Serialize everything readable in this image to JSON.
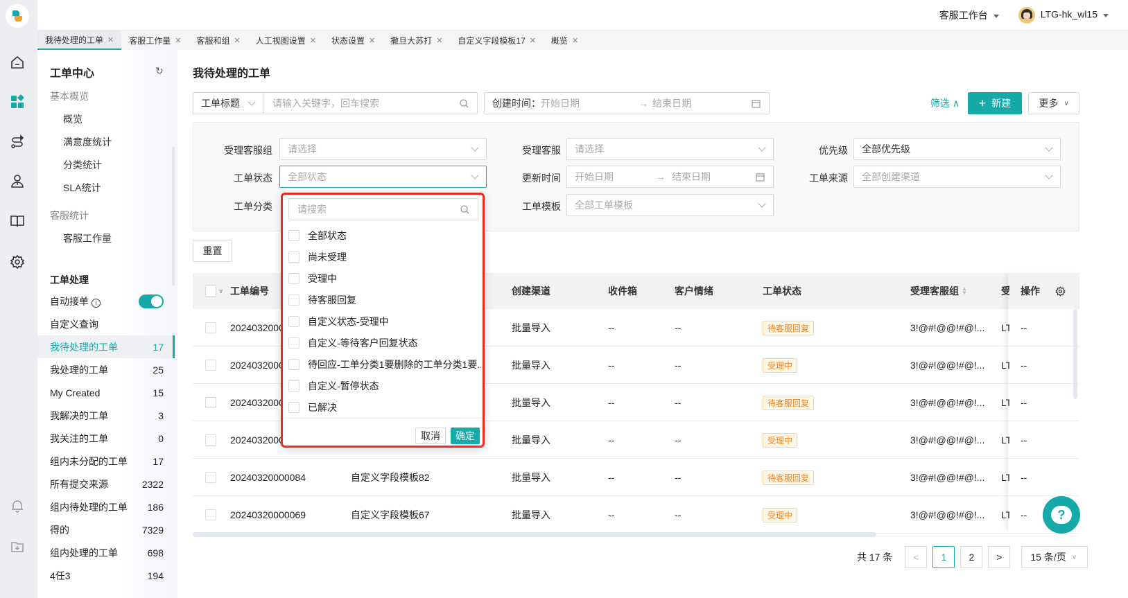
{
  "app": {
    "workspace_label": "客服工作台",
    "user_name": "LTG-hk_wl15",
    "brand_color": "#15a9a8"
  },
  "rail_icons": [
    "home-icon",
    "apps-icon",
    "route-icon",
    "agent-icon",
    "book-icon",
    "gear-icon",
    "bell-icon",
    "download-folder-icon"
  ],
  "tabs": [
    {
      "label": "我待处理的工单",
      "active": true
    },
    {
      "label": "客服工作量"
    },
    {
      "label": "客服和组"
    },
    {
      "label": "人工视图设置"
    },
    {
      "label": "状态设置"
    },
    {
      "label": "撒旦大苏打"
    },
    {
      "label": "自定义字段模板17"
    },
    {
      "label": "概览"
    }
  ],
  "sidebar": {
    "title": "工单中心",
    "group_basic": "基本概览",
    "basic_items": [
      "概览",
      "满意度统计",
      "分类统计",
      "SLA统计"
    ],
    "group_agent": "客服统计",
    "agent_items": [
      "客服工作量"
    ],
    "section_process": "工单处理",
    "auto_accept_label": "自动接单",
    "auto_accept_on": true,
    "custom_query": "自定义查询",
    "views": [
      {
        "label": "我待处理的工单",
        "count": "17",
        "active": true
      },
      {
        "label": "我处理的工单",
        "count": "25"
      },
      {
        "label": "My Created",
        "count": "15"
      },
      {
        "label": "我解决的工单",
        "count": "3"
      },
      {
        "label": "我关注的工单",
        "count": "0"
      },
      {
        "label": "组内未分配的工单",
        "count": "17"
      },
      {
        "label": "所有提交来源",
        "count": "2322"
      },
      {
        "label": "组内待处理的工单",
        "count": "186"
      },
      {
        "label": "得的",
        "count": "7329"
      },
      {
        "label": "组内处理的工单",
        "count": "698"
      },
      {
        "label": "4任3",
        "count": "194"
      }
    ]
  },
  "main": {
    "title": "我待处理的工单",
    "search_field_select": "工单标题",
    "search_placeholder": "请输入关键字，回车搜索",
    "created_time_label": "创建时间：",
    "start_date_placeholder": "开始日期",
    "end_date_placeholder": "结束日期",
    "filter_toggle": "筛选",
    "new_button": "新建",
    "more_button": "更多"
  },
  "filters": {
    "group_label": "受理客服组",
    "group_placeholder": "请选择",
    "agent_label": "受理客服",
    "agent_placeholder": "请选择",
    "priority_label": "优先级",
    "priority_value": "全部优先级",
    "status_label": "工单状态",
    "status_placeholder": "全部状态",
    "updated_label": "更新时间",
    "updated_start": "开始日期",
    "updated_end": "结束日期",
    "source_label": "工单来源",
    "source_placeholder": "全部创建渠道",
    "category_label": "工单分类",
    "template_label": "工单模板",
    "template_placeholder": "全部工单模板",
    "reset_button": "重置"
  },
  "status_dropdown": {
    "search_placeholder": "请搜索",
    "options": [
      "全部状态",
      "尚未受理",
      "受理中",
      "待客服回复",
      "自定义状态-受理中",
      "自定义-等待客户回复状态",
      "待回应-工单分类1要删除的工单分类1要...",
      "自定义-暂停状态",
      "已解决"
    ],
    "cancel": "取消",
    "confirm": "确定"
  },
  "table": {
    "columns": [
      "工单编号",
      "创建渠道",
      "收件箱",
      "客户情绪",
      "工单状态",
      "受理客服组",
      "受",
      "操作"
    ],
    "rows": [
      {
        "id": "2024032000",
        "title": "",
        "channel": "批量导入",
        "inbox": "--",
        "mood": "--",
        "status": "待客服回复",
        "group": "3!@#!@@!#@!...",
        "agent": "LT",
        "ops": "--"
      },
      {
        "id": "2024032000",
        "title": "",
        "channel": "批量导入",
        "inbox": "--",
        "mood": "--",
        "status": "受理中",
        "group": "3!@#!@@!#@!...",
        "agent": "LT",
        "ops": "--"
      },
      {
        "id": "2024032000",
        "title": "",
        "channel": "批量导入",
        "inbox": "--",
        "mood": "--",
        "status": "待客服回复",
        "group": "3!@#!@@!#@!...",
        "agent": "LT",
        "ops": "--"
      },
      {
        "id": "2024032000",
        "title": "",
        "channel": "批量导入",
        "inbox": "--",
        "mood": "--",
        "status": "受理中",
        "group": "3!@#!@@!#@!...",
        "agent": "LT",
        "ops": "--"
      },
      {
        "id": "20240320000084",
        "title": "自定义字段模板82",
        "channel": "批量导入",
        "inbox": "--",
        "mood": "--",
        "status": "待客服回复",
        "group": "3!@#!@@!#@!...",
        "agent": "LT",
        "ops": "--"
      },
      {
        "id": "20240320000069",
        "title": "自定义字段模板67",
        "channel": "批量导入",
        "inbox": "--",
        "mood": "--",
        "status": "受理中",
        "group": "3!@#!@@!#@!...",
        "agent": "LT",
        "ops": "--"
      }
    ]
  },
  "pagination": {
    "total_label": "共 17 条",
    "pages": [
      "1",
      "2"
    ],
    "current": "1",
    "page_size": "15 条/页",
    "prev": "<",
    "next": ">"
  },
  "help_button": "?"
}
